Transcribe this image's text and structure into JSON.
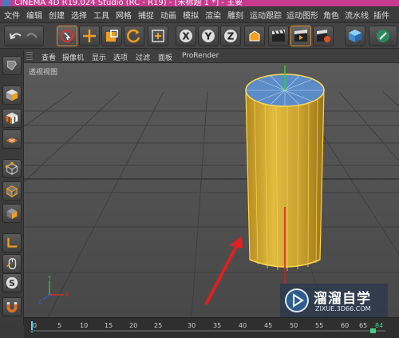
{
  "window": {
    "title": "CINEMA 4D R19.024 Studio (RC - R19) - [未标题 1 *] - 主要"
  },
  "menu": {
    "items": [
      "文件",
      "编辑",
      "创建",
      "选择",
      "工具",
      "网格",
      "捕捉",
      "动画",
      "模拟",
      "渲染",
      "雕刻",
      "运动跟踪",
      "运动图形",
      "角色",
      "流水线",
      "插件"
    ]
  },
  "toolbar": {
    "axis_x": "X",
    "axis_y": "Y",
    "axis_z": "Z"
  },
  "viewport_menu": {
    "items": [
      "查看",
      "摄像机",
      "显示",
      "选项",
      "过滤",
      "面板"
    ],
    "prorender": "ProRender",
    "view_label": "透视视图"
  },
  "timeline": {
    "ticks": [
      "0",
      "5",
      "10",
      "15",
      "20",
      "25",
      "30",
      "35",
      "40",
      "45",
      "50",
      "55",
      "60",
      "65"
    ],
    "end_label": "84"
  },
  "watermark": {
    "title": "溜溜自学",
    "url": "ZIXUE.3D66.COM"
  },
  "colors": {
    "title_bar": "#c73a8e",
    "cylinder": "#d6b23a",
    "cylinder_edge": "#ffd84a",
    "cap": "#5c8cc8",
    "arrow": "#e02020",
    "accent": "#e08a2a"
  }
}
